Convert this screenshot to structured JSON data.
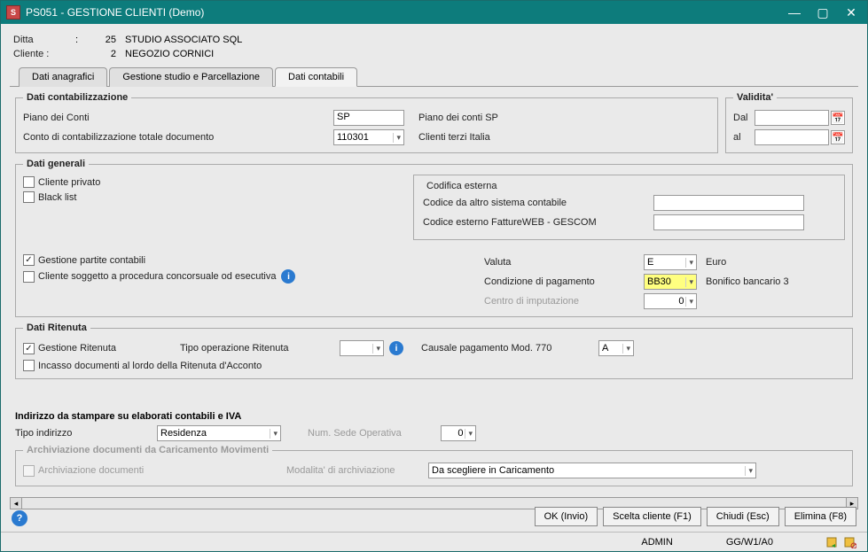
{
  "window": {
    "title": "PS051 - GESTIONE CLIENTI  (Demo)"
  },
  "header": {
    "ditta_label": "Ditta",
    "ditta_num": "25",
    "ditta_val": "STUDIO ASSOCIATO SQL",
    "cliente_label": "Cliente :",
    "cliente_num": "2",
    "cliente_val": "NEGOZIO CORNICI"
  },
  "tabs": {
    "t1": "Dati anagrafici",
    "t2": "Gestione studio e Parcellazione",
    "t3": "Dati contabili"
  },
  "dati_cont": {
    "legend": "Dati contabilizzazione",
    "piano_conti_lbl": "Piano dei Conti",
    "piano_conti_val": "SP",
    "piano_conti_desc": "Piano dei conti SP",
    "conto_lbl": "Conto di contabilizzazione totale documento",
    "conto_val": "110301",
    "conto_desc": "Clienti terzi Italia"
  },
  "validita": {
    "legend": "Validita'",
    "dal_lbl": "Dal",
    "al_lbl": "al"
  },
  "dati_gen": {
    "legend": "Dati generali",
    "cliente_privato": "Cliente privato",
    "black_list": "Black list",
    "codifica_legend": "Codifica esterna",
    "codice_altro": "Codice da altro sistema contabile",
    "codice_fweb": "Codice esterno FattureWEB - GESCOM",
    "gestione_partite": "Gestione partite contabili",
    "cliente_concors": "Cliente soggetto a procedura concorsuale od esecutiva",
    "valuta_lbl": "Valuta",
    "valuta_val": "E",
    "valuta_desc": "Euro",
    "cond_pag_lbl": "Condizione di pagamento",
    "cond_pag_val": "BB30",
    "cond_pag_desc": "Bonifico bancario 3",
    "centro_lbl": "Centro di imputazione",
    "centro_val": "0"
  },
  "dati_rit": {
    "legend": "Dati Ritenuta",
    "gest_rit": "Gestione Ritenuta",
    "tipo_op": "Tipo operazione Ritenuta",
    "causale": "Causale pagamento Mod. 770",
    "causale_val": "A",
    "incasso": "Incasso documenti al lordo della Ritenuta d'Acconto"
  },
  "indirizzo": {
    "title": "Indirizzo da stampare su elaborati contabili e IVA",
    "tipo_lbl": "Tipo indirizzo",
    "tipo_val": "Residenza",
    "num_sede_lbl": "Num. Sede Operativa",
    "num_sede_val": "0"
  },
  "arch": {
    "legend": "Archiviazione documenti da Caricamento Movimenti",
    "arch_doc": "Archiviazione documenti",
    "modalita_lbl": "Modalita' di archiviazione",
    "modalita_val": "Da scegliere in Caricamento"
  },
  "buttons": {
    "ok": "OK (Invio)",
    "scelta": "Scelta cliente (F1)",
    "chiudi": "Chiudi (Esc)",
    "elimina": "Elimina (F8)"
  },
  "status": {
    "user": "ADMIN",
    "code": "GG/W1/A0"
  }
}
